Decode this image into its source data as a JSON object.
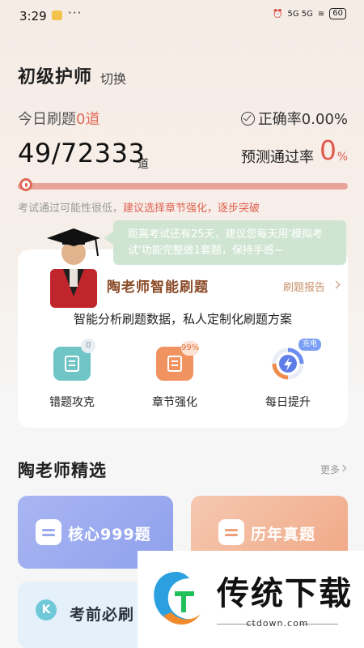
{
  "status_bar": {
    "time": "3:29",
    "dots": "···",
    "network": "5G 5G",
    "battery": "60"
  },
  "header": {
    "title": "初级护师",
    "switch_label": "切换"
  },
  "stats": {
    "today_label": "今日刷题",
    "today_count": "0道",
    "accuracy_label": "正确率0.00%",
    "progress_count": "49/72333",
    "progress_unit": "道",
    "pass_rate_label": "预测通过率",
    "pass_rate_value": "0",
    "pass_rate_unit": "%",
    "pass_rate_fraction": 0.0
  },
  "hint": {
    "prefix": "考试通过可能性很低，",
    "highlight": "建议选择章节强化，逐步突破"
  },
  "teacher_card": {
    "speech": "距离考试还有25天，建议您每天用'模拟考试'功能完整做1套题，保持手感~",
    "title": "陶老师智能刷题",
    "report_link": "刷题报告",
    "subtitle": "智能分析刷题数据，私人定制化刷题方案",
    "features": [
      {
        "label": "错题攻克",
        "badge": "0"
      },
      {
        "label": "章节强化",
        "badge": "99%"
      },
      {
        "label": "每日提升",
        "badge": "充电"
      }
    ]
  },
  "selection": {
    "title": "陶老师精选",
    "more_label": "更多",
    "tiles": [
      {
        "label": "核心999题"
      },
      {
        "label": "历年真题"
      },
      {
        "label": "考前必刷",
        "icon_letter": "K"
      }
    ]
  },
  "watermark": {
    "brand": "传统下载",
    "domain": "ctdown.com"
  },
  "colors": {
    "accent_red": "#e05a4c",
    "brand_brown": "#8a4a26",
    "speech_green": "#cfe5d2"
  }
}
